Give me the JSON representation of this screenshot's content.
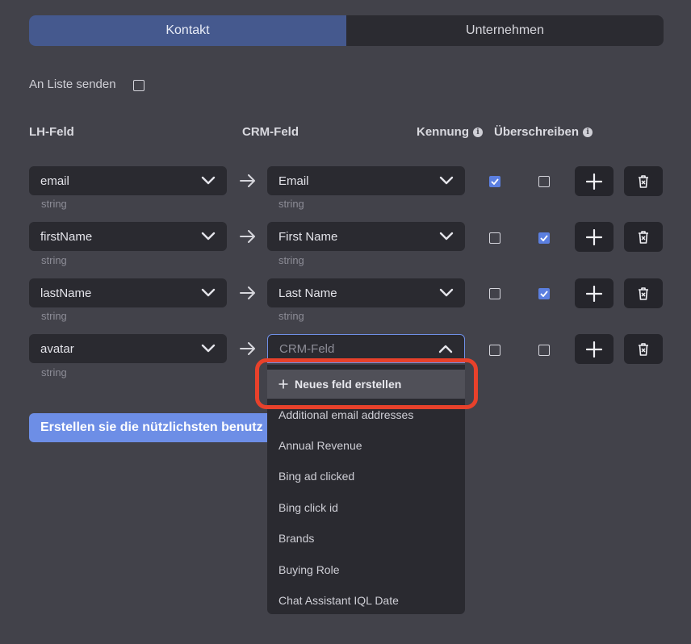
{
  "tabs": [
    {
      "label": "Kontakt",
      "active": true
    },
    {
      "label": "Unternehmen",
      "active": false
    }
  ],
  "send_to_list": {
    "label": "An Liste senden",
    "checked": false
  },
  "headers": {
    "lh_field": "LH-Feld",
    "crm_field": "CRM-Feld",
    "identifier": "Kennung",
    "overwrite": "Überschreiben"
  },
  "rows": [
    {
      "lh": "email",
      "lh_type": "string",
      "crm": "Email",
      "crm_type": "string",
      "identifier": true,
      "overwrite": false
    },
    {
      "lh": "firstName",
      "lh_type": "string",
      "crm": "First Name",
      "crm_type": "string",
      "identifier": false,
      "overwrite": true
    },
    {
      "lh": "lastName",
      "lh_type": "string",
      "crm": "Last Name",
      "crm_type": "string",
      "identifier": false,
      "overwrite": true
    },
    {
      "lh": "avatar",
      "lh_type": "string",
      "crm_placeholder": "CRM-Feld",
      "identifier": false,
      "overwrite": false
    }
  ],
  "create_button": "Erstellen sie die nützlichsten benutz",
  "dropdown": {
    "new_field": "Neues feld erstellen",
    "options": [
      "Additional email addresses",
      "Annual Revenue",
      "Bing ad clicked",
      "Bing click id",
      "Brands",
      "Buying Role",
      "Chat Assistant IQL Date"
    ]
  },
  "colors": {
    "background": "#42424a",
    "tab_active": "#45598e",
    "accent": "#5b7fe0",
    "button_primary": "#6d8ee6",
    "highlight": "#e8412b"
  }
}
